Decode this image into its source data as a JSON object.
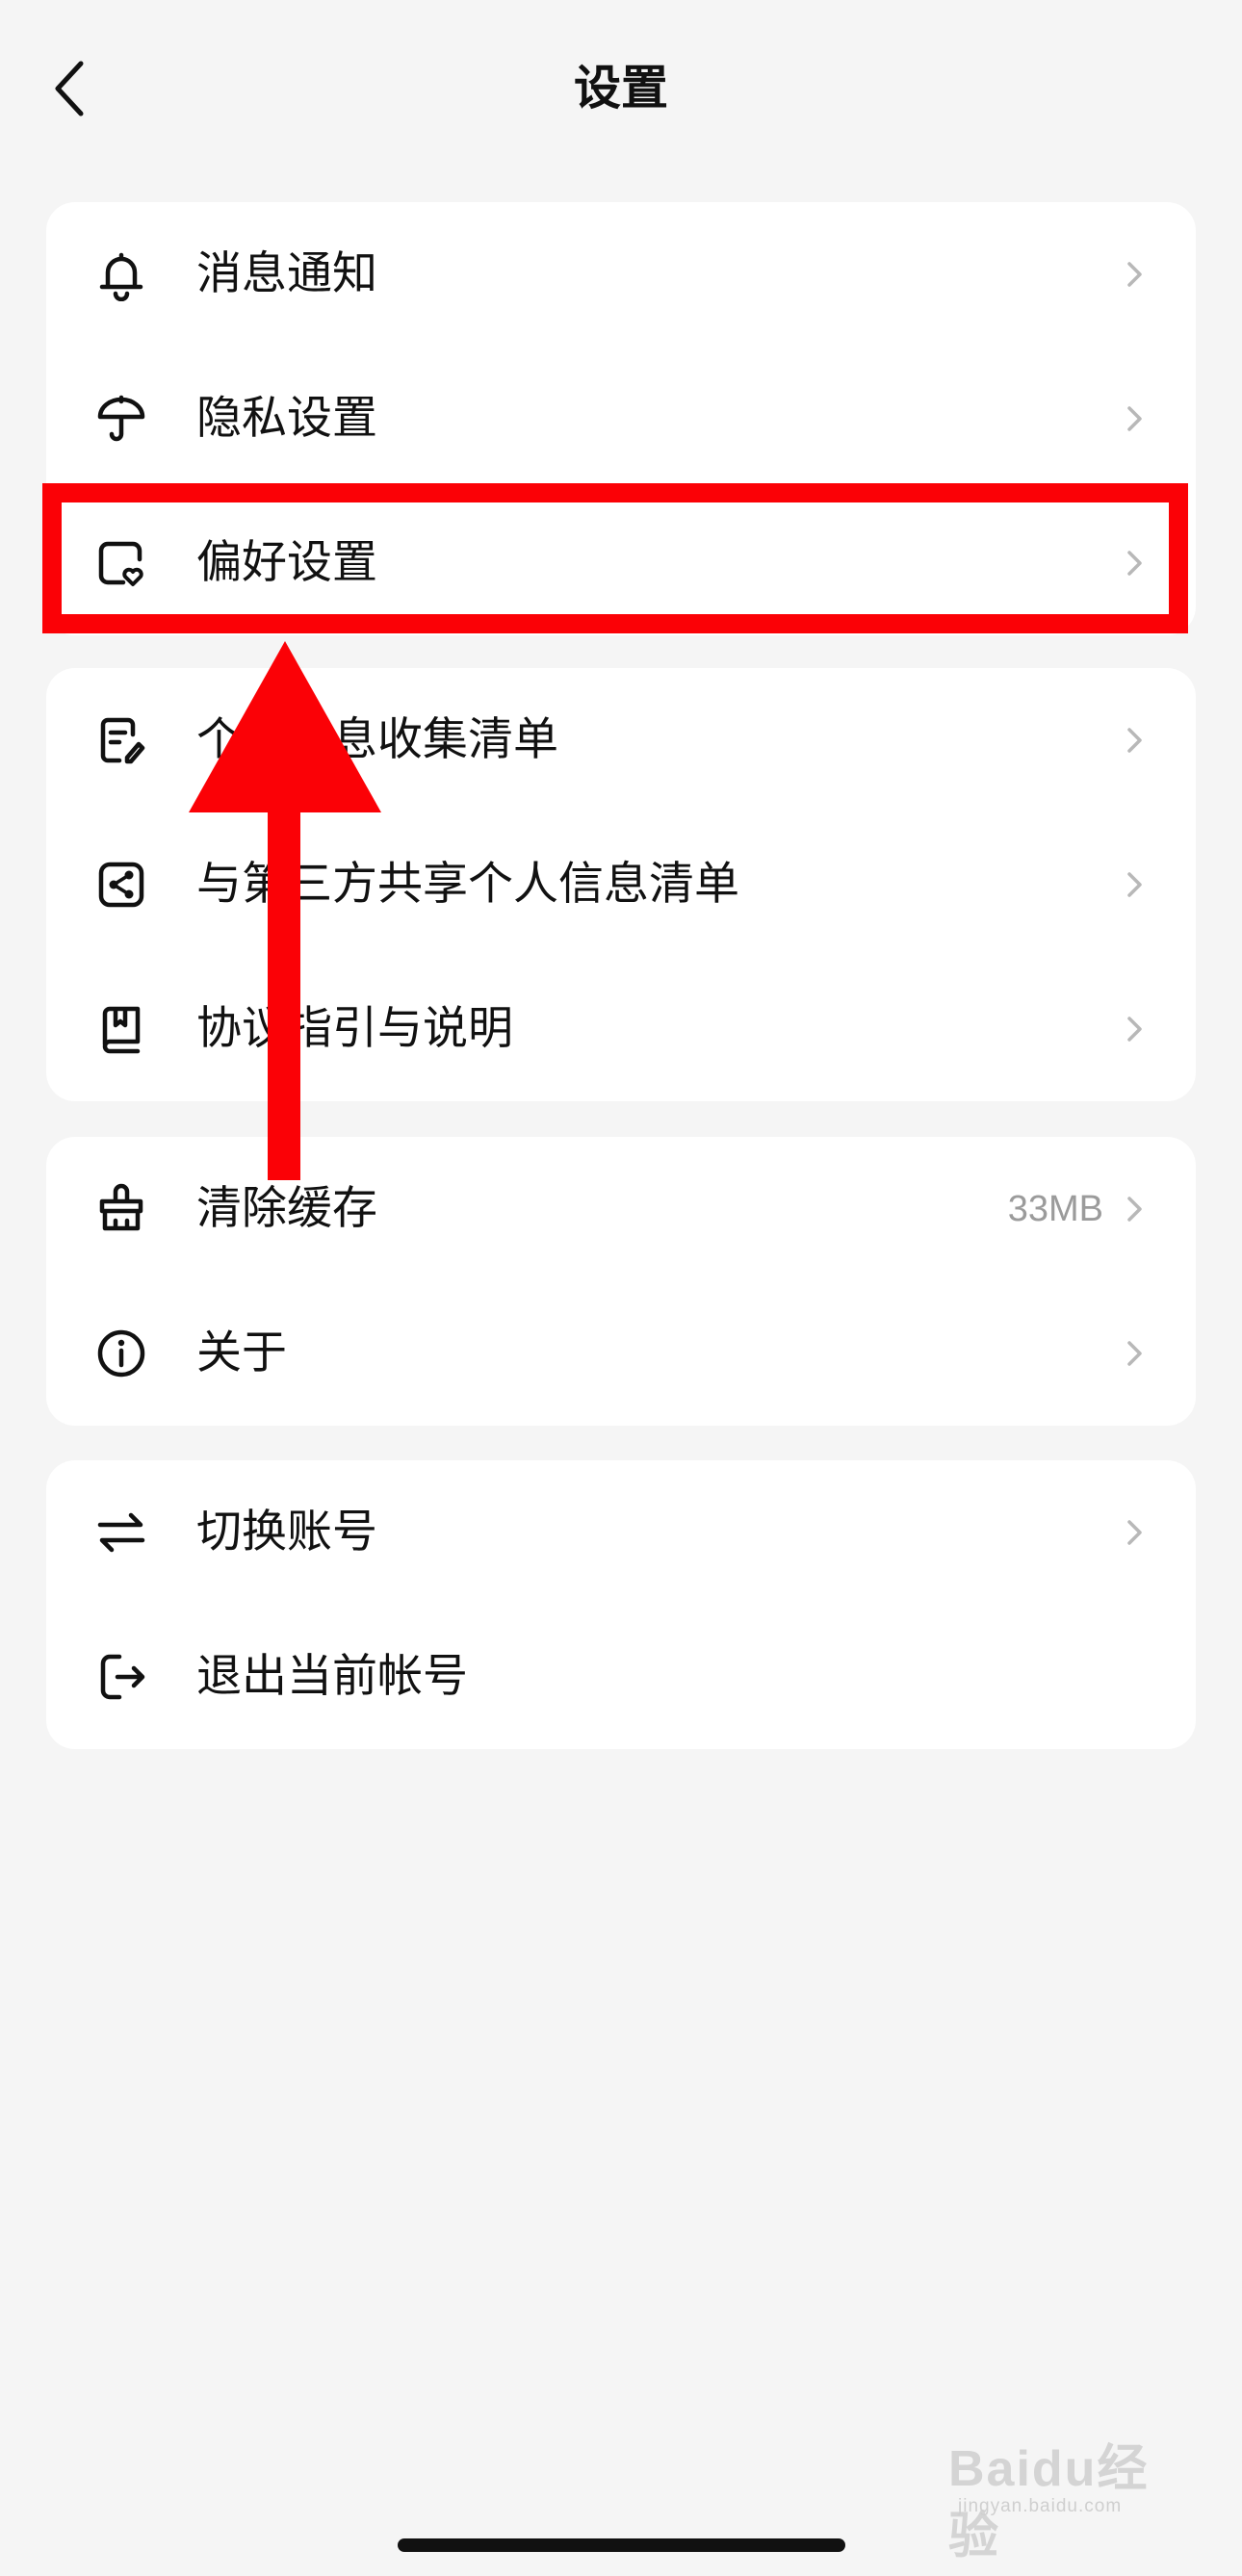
{
  "header": {
    "title": "设置",
    "back_icon": "chevron-left-icon"
  },
  "groups": [
    {
      "items": [
        {
          "label": "消息通知",
          "icon": "bell-icon"
        },
        {
          "label": "隐私设置",
          "icon": "umbrella-icon"
        },
        {
          "label": "偏好设置",
          "icon": "preference-heart-icon"
        }
      ]
    },
    {
      "items": [
        {
          "label": "个人信息收集清单",
          "icon": "list-edit-icon"
        },
        {
          "label": "与第三方共享个人信息清单",
          "icon": "share-icon"
        },
        {
          "label": "协议指引与说明",
          "icon": "book-icon"
        }
      ]
    },
    {
      "items": [
        {
          "label": "清除缓存",
          "icon": "broom-icon",
          "value": "33MB"
        },
        {
          "label": "关于",
          "icon": "info-icon"
        }
      ]
    },
    {
      "items": [
        {
          "label": "切换账号",
          "icon": "switch-arrows-icon"
        },
        {
          "label": "退出当前帐号",
          "icon": "logout-icon"
        }
      ]
    }
  ],
  "annotation": {
    "highlight_color": "#fb0106"
  },
  "watermark": {
    "text": "Baidu经验",
    "sub": "jingyan.baidu.com"
  },
  "colors": {
    "background": "#f5f5f5",
    "card": "#ffffff",
    "text": "#111111",
    "muted": "#9b9b9b",
    "chevron": "#b8b8b8"
  }
}
